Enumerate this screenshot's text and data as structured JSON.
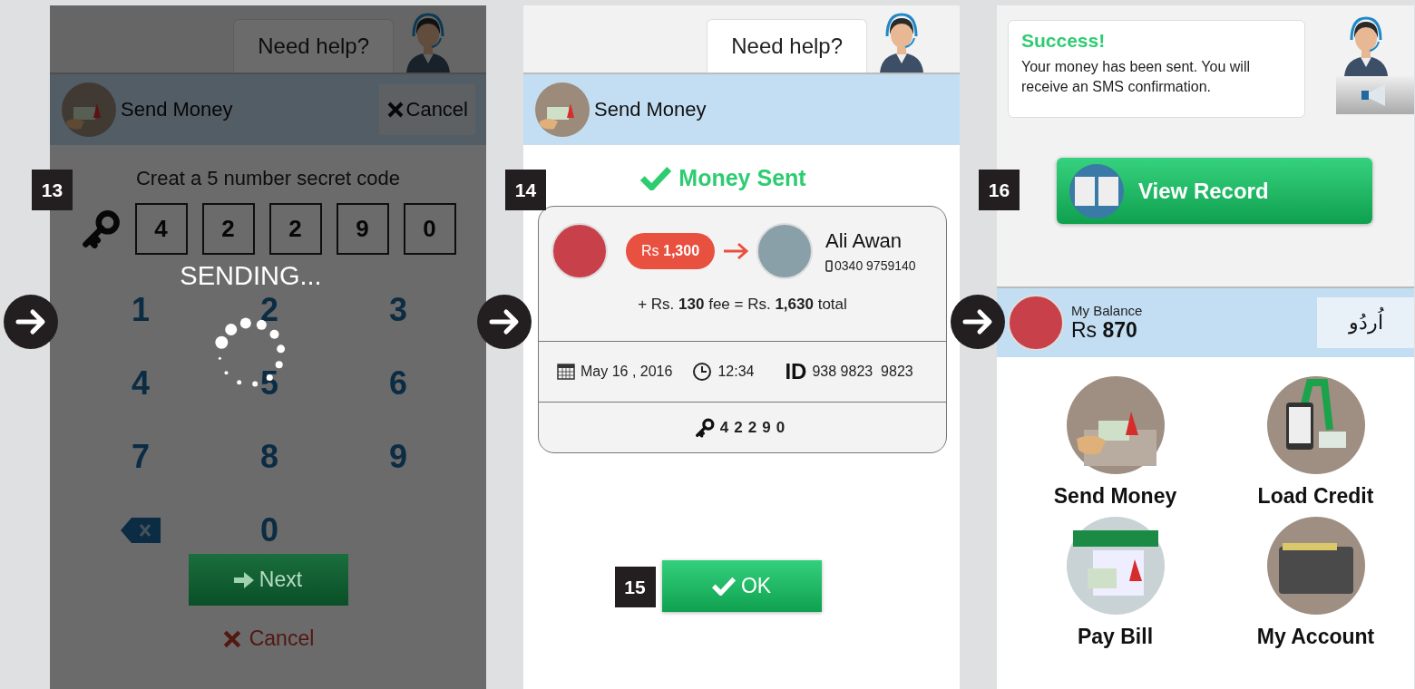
{
  "screen_code": {
    "step": "13",
    "help": "Need help?",
    "header": {
      "title": "Send Money",
      "cancel": "Cancel"
    },
    "prompt": "Creat a 5 number secret code",
    "code": [
      "4",
      "2",
      "2",
      "9",
      "0"
    ],
    "keypad": [
      {
        "kind": "digit",
        "label": "1"
      },
      {
        "kind": "digit",
        "label": "2"
      },
      {
        "kind": "digit",
        "label": "3"
      },
      {
        "kind": "digit",
        "label": "4"
      },
      {
        "kind": "digit",
        "label": "5"
      },
      {
        "kind": "digit",
        "label": "6"
      },
      {
        "kind": "digit",
        "label": "7"
      },
      {
        "kind": "digit",
        "label": "8"
      },
      {
        "kind": "digit",
        "label": "9"
      },
      {
        "kind": "backspace"
      },
      {
        "kind": "digit",
        "label": "0"
      }
    ],
    "next": "Next",
    "cancel": "Cancel",
    "overlay": {
      "text": "SENDING..."
    }
  },
  "screen_receipt": {
    "step": "14",
    "help": "Need help?",
    "header": {
      "title": "Send Money"
    },
    "status": "Money Sent",
    "transfer": {
      "amount": "Rs **1,300**",
      "recipient": "Ali Awan",
      "phone": "0340 9759140",
      "fee_line": "+ Rs. **130** fee = Rs. **1,630** total",
      "date": "May 16 , 2016",
      "time": "12:34",
      "id_label": "ID",
      "id": "938 9823  9823",
      "code": "42290"
    },
    "ok": {
      "label": "OK",
      "step": "15"
    }
  },
  "screen_home": {
    "step": "16",
    "bubble": {
      "title": "Success!",
      "message": "Your money has been sent. You will receive an SMS confirmation."
    },
    "view_record": "View Record",
    "balance": {
      "label": "My Balance",
      "amount": "Rs **870**",
      "language": "اُردُو"
    },
    "tiles": [
      {
        "kind": "send",
        "label": "Send Money"
      },
      {
        "kind": "credit",
        "label": "Load Credit"
      },
      {
        "kind": "bill",
        "label": "Pay Bill"
      },
      {
        "kind": "account",
        "label": "My Account"
      }
    ]
  }
}
